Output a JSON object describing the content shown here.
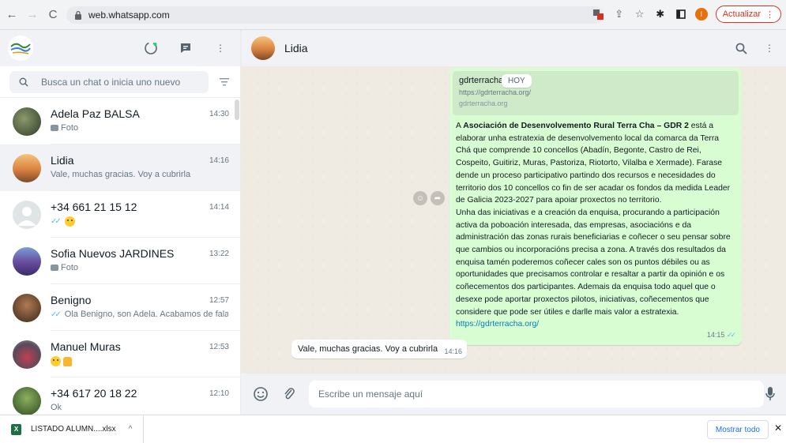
{
  "browser": {
    "url": "web.whatsapp.com",
    "update_label": "Actualizar",
    "profile_initial": "I"
  },
  "sidebar": {
    "search_placeholder": "Busca un chat o inicia uno nuevo",
    "chats": [
      {
        "name": "Adela Paz BALSA",
        "time": "14:30",
        "preview": "Foto",
        "avatar_color": "#4a5a3c"
      },
      {
        "name": "Lidia",
        "time": "14:16",
        "preview": "Vale, muchas gracias. Voy a cubrirla",
        "avatar_color": "#d98a4a",
        "active": true
      },
      {
        "name": "+34 661 21 15 12",
        "time": "14:14",
        "preview": "",
        "avatar_color": "#dfe5e7"
      },
      {
        "name": "Sofia Nuevos JARDINES",
        "time": "13:22",
        "preview": "Foto",
        "avatar_color": "#6a4fa0"
      },
      {
        "name": "Benigno",
        "time": "12:57",
        "preview": "Ola Benigno, son Adela. Acabamos de falar, ...",
        "avatar_color": "#6b4a34"
      },
      {
        "name": "Manuel Muras",
        "time": "12:53",
        "preview": "",
        "avatar_color": "#8a6a7a"
      },
      {
        "name": "+34 617 20 18 22",
        "time": "12:10",
        "preview": "Ok",
        "avatar_color": "#4f7a3a"
      }
    ]
  },
  "chat": {
    "contact_name": "Lidia",
    "today_label": "HOY",
    "link_preview": {
      "title": "gdrterracha.o",
      "url": "https://gdrterracha.org/",
      "domain": "gdrterracha.org"
    },
    "message": {
      "intro": "A ",
      "org": "Asociación de Desenvolvemento Rural Terra Cha – GDR 2",
      "p1": " está a elaborar unha estratexia de desenvolvemento local da comarca da Terra Chá que comprende 10 concellos (Abadín, Begonte, Castro de Rei, Cospeito, Guitiriz, Muras, Pastoriza, Riotorto, Vilalba  e Xermade). Farase dende un proceso participativo partindo dos recursos e necesidades do territorio dos 10 concellos co fin de ser acadar os fondos da medida Leader de Galicia 2023-2027 para apoiar proxectos no territorio.",
      "p2": "Unha das iniciativas e a creación da enquisa, procurando a participación activa da poboación interesada, das empresas, asociacións e da administración das zonas rurais beneficiarias e coñecer o seu pensar sobre que cambios ou incorporacións precisa a zona. A través dos resultados da enquisa tamén poderemos coñecer cales son os puntos débiles ou as oportunidades que precisamos controlar e resaltar a partir da opinión e os coñecementos dos participantes. Ademais da enquisa todo aquel que o desexe pode aportar proxectos pilotos, iniciativas, coñecementos que considere que pode ser útiles e darlle mais valor a estratexia.",
      "link": "https://gdrterracha.org/",
      "time": "14:15"
    },
    "reply": {
      "text": "Vale, muchas gracias. Voy a cubrirla",
      "time": "14:16"
    },
    "composer_placeholder": "Escribe un mensaje aquí"
  },
  "downloads": {
    "file_name": "LISTADO ALUMN....xlsx",
    "show_all_label": "Mostrar todo"
  }
}
